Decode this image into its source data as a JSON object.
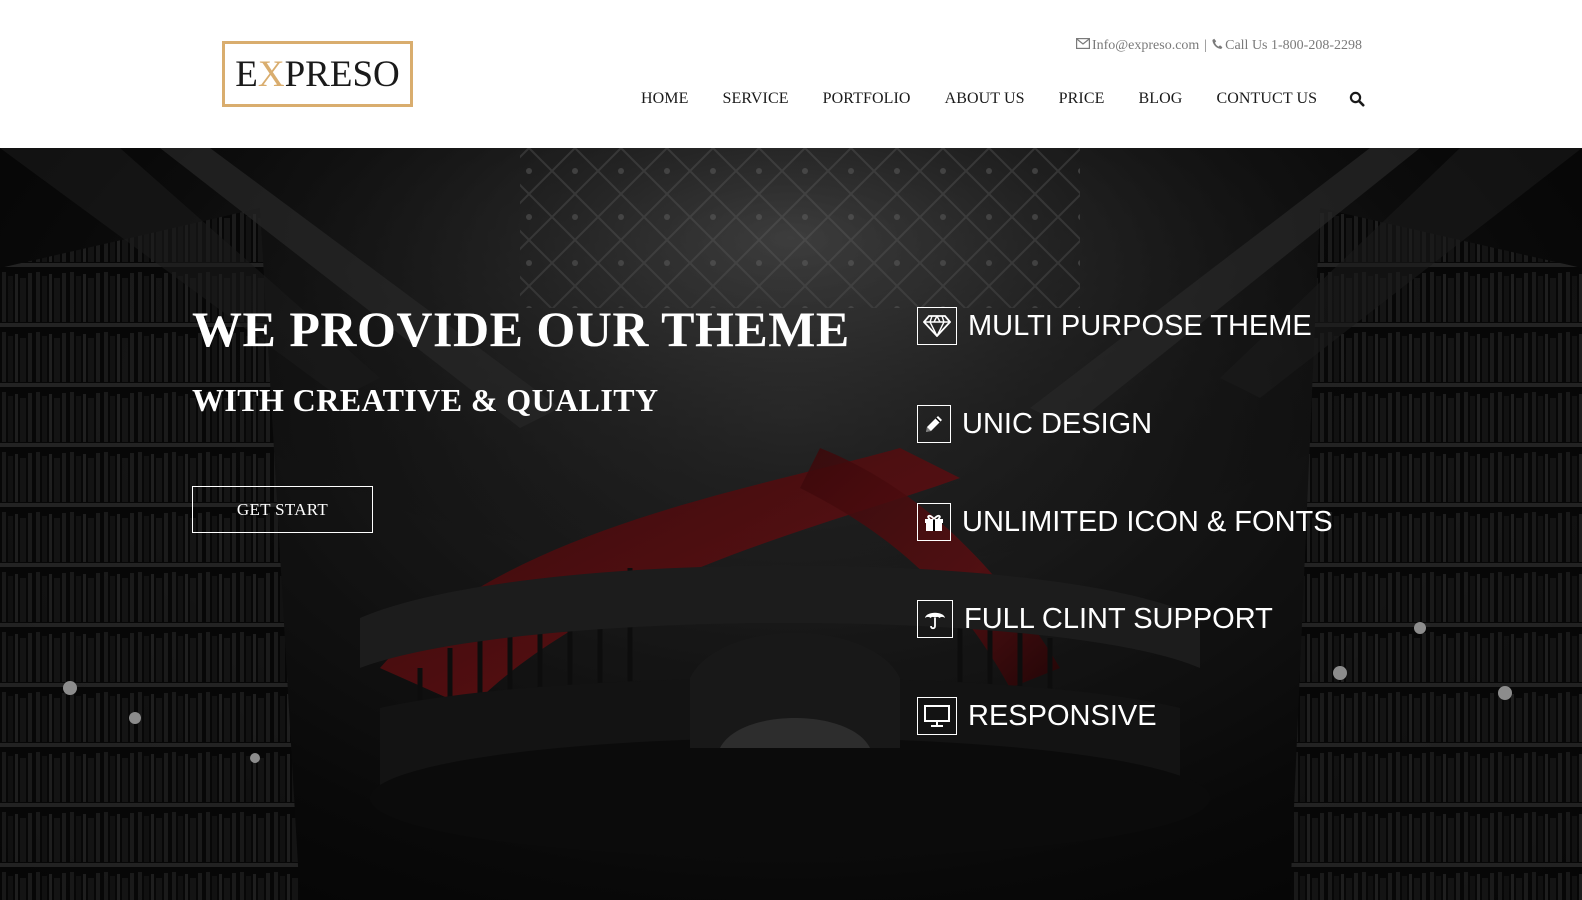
{
  "header": {
    "logo": {
      "before": "E",
      "accent": "X",
      "after": "PRESO"
    },
    "contact": {
      "email": "Info@expreso.com",
      "separator": "|",
      "phone": "Call Us 1-800-208-2298"
    },
    "nav": [
      "HOME",
      "SERVICE",
      "PORTFOLIO",
      "ABOUT US",
      "PRICE",
      "BLOG",
      "CONTUCT US"
    ],
    "search_icon": "search-icon"
  },
  "hero": {
    "title": "WE PROVIDE OUR THEME",
    "subtitle": "WITH CREATIVE & QUALITY",
    "button": "GET START",
    "features": [
      {
        "icon": "diamond-icon",
        "label": "MULTI PURPOSE THEME"
      },
      {
        "icon": "pencil-icon",
        "label": "UNIC DESIGN"
      },
      {
        "icon": "gift-icon",
        "label": "UNLIMITED ICON & FONTS"
      },
      {
        "icon": "umbrella-icon",
        "label": "FULL CLINT SUPPORT"
      },
      {
        "icon": "monitor-icon",
        "label": "RESPONSIVE"
      }
    ]
  },
  "colors": {
    "accent": "#d9ad6e",
    "text_dark": "#1a1a1a",
    "text_muted": "#7a7a7a",
    "hero_text": "#ffffff",
    "carpet_red": "#7a1418"
  }
}
